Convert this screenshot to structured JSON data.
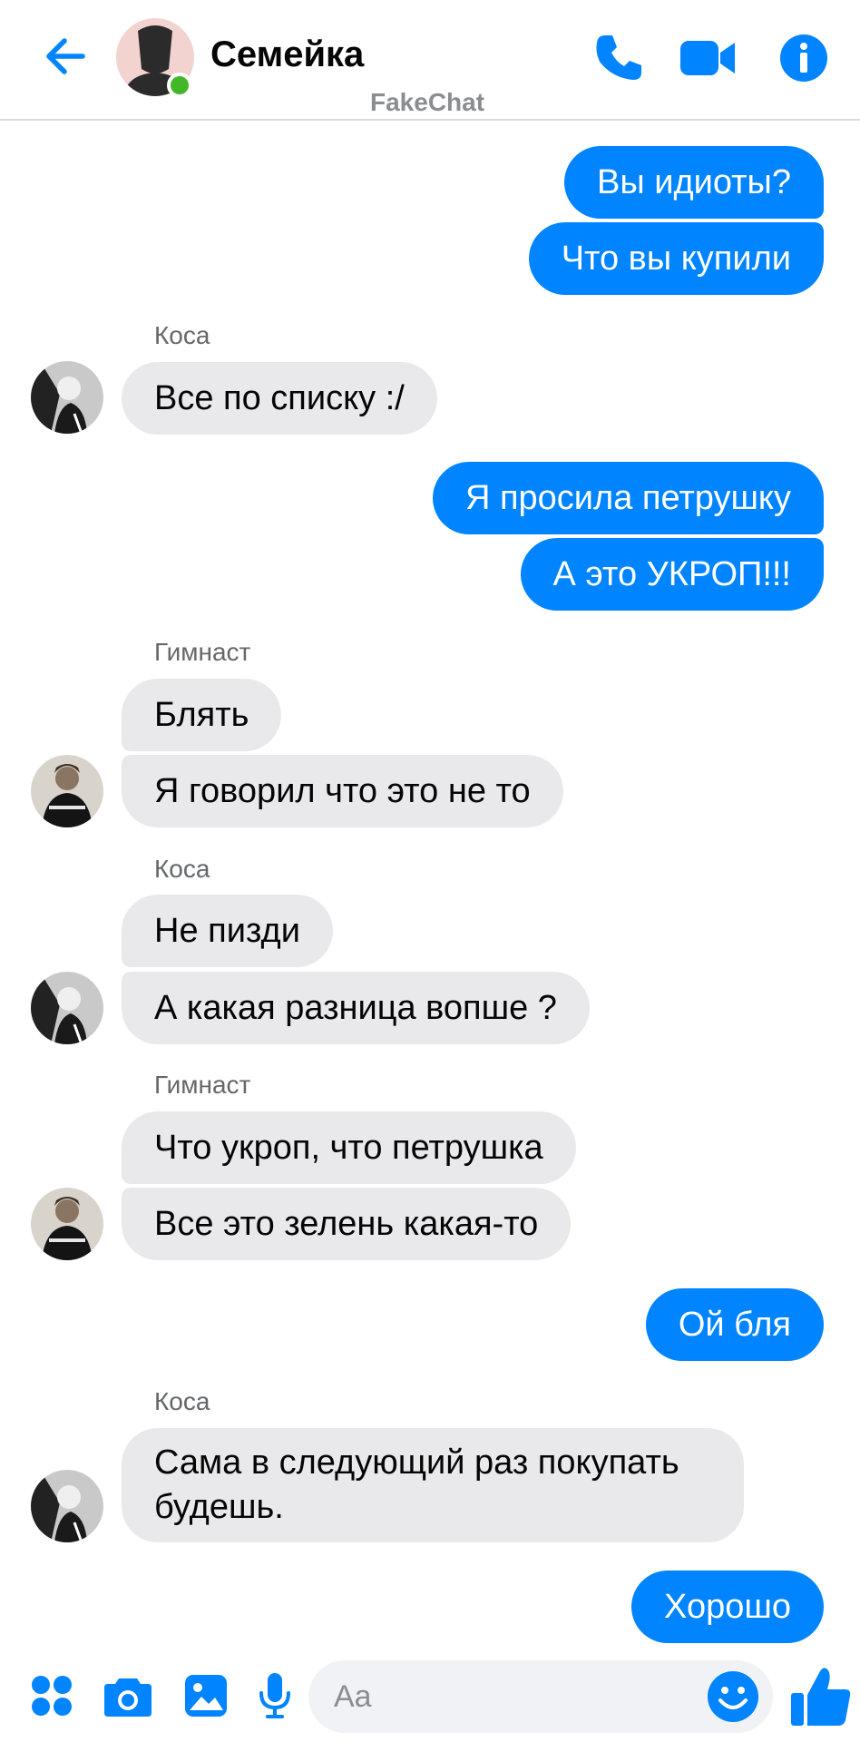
{
  "header": {
    "title": "Семейка",
    "watermark": "FakeChat",
    "accent_color": "#0084ff",
    "online_color": "#42b72a",
    "icons": [
      "back-arrow-icon",
      "phone-icon",
      "video-camera-icon",
      "info-icon"
    ]
  },
  "messages": [
    {
      "direction": "out",
      "text": "Вы идиоты?"
    },
    {
      "direction": "out",
      "text": "Что вы купили"
    },
    {
      "direction": "in",
      "sender": "Коса",
      "text": "Все по списку :/"
    },
    {
      "direction": "out",
      "text": "Я просила петрушку"
    },
    {
      "direction": "out",
      "text": "А это УКРОП!!!"
    },
    {
      "direction": "in",
      "sender": "Гимнаст",
      "text": "Блять"
    },
    {
      "direction": "in",
      "text": "Я говорил что это не то"
    },
    {
      "direction": "in",
      "sender": "Коса",
      "text": "Не пизди"
    },
    {
      "direction": "in",
      "text": "А какая разница вопше ?"
    },
    {
      "direction": "in",
      "sender": "Гимнаст",
      "text": "Что укроп, что петрушка"
    },
    {
      "direction": "in",
      "text": "Все это зелень какая-то"
    },
    {
      "direction": "out",
      "text": "Ой бля"
    },
    {
      "direction": "in",
      "sender": "Коса",
      "text": "Сама в следующий раз покупать будешь."
    },
    {
      "direction": "out",
      "text": "Хорошо"
    }
  ],
  "composer": {
    "placeholder": "Aa",
    "icons": [
      "menu-dots-icon",
      "camera-icon",
      "gallery-icon",
      "microphone-icon",
      "emoji-icon",
      "thumbs-up-icon"
    ]
  }
}
